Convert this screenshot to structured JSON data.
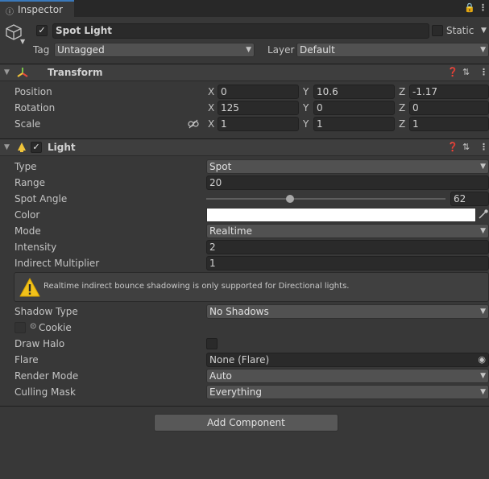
{
  "tab": {
    "label": "Inspector"
  },
  "object": {
    "name": "Spot Light",
    "active": true,
    "static_label": "Static",
    "tag_label": "Tag",
    "tag_value": "Untagged",
    "layer_label": "Layer",
    "layer_value": "Default"
  },
  "transform": {
    "title": "Transform",
    "position_label": "Position",
    "rotation_label": "Rotation",
    "scale_label": "Scale",
    "axes": {
      "x": "X",
      "y": "Y",
      "z": "Z"
    },
    "position": {
      "x": "0",
      "y": "10.6",
      "z": "-1.17"
    },
    "rotation": {
      "x": "125",
      "y": "0",
      "z": "0"
    },
    "scale": {
      "x": "1",
      "y": "1",
      "z": "1"
    }
  },
  "light": {
    "title": "Light",
    "enabled": true,
    "type_label": "Type",
    "type_value": "Spot",
    "range_label": "Range",
    "range_value": "20",
    "spot_angle_label": "Spot Angle",
    "spot_angle_value": "62",
    "spot_angle_fraction": 0.35,
    "color_label": "Color",
    "color_value": "#ffffff",
    "mode_label": "Mode",
    "mode_value": "Realtime",
    "intensity_label": "Intensity",
    "intensity_value": "2",
    "indirect_label": "Indirect Multiplier",
    "indirect_value": "1",
    "warning": "Realtime indirect bounce shadowing is only supported for Directional lights.",
    "shadow_label": "Shadow Type",
    "shadow_value": "No Shadows",
    "cookie_label": "Cookie",
    "halo_label": "Draw Halo",
    "flare_label": "Flare",
    "flare_value": "None (Flare)",
    "render_mode_label": "Render Mode",
    "render_mode_value": "Auto",
    "culling_label": "Culling Mask",
    "culling_value": "Everything"
  },
  "add_component_label": "Add Component"
}
